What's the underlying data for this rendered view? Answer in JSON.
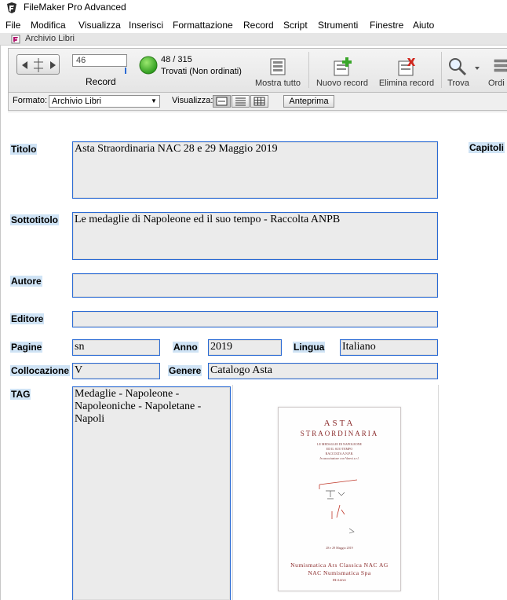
{
  "app": {
    "title": "FileMaker Pro Advanced"
  },
  "menu": [
    "File",
    "Modifica",
    "Visualizza",
    "Inserisci",
    "Formattazione",
    "Record",
    "Script",
    "Strumenti",
    "Finestre",
    "Aiuto"
  ],
  "window": {
    "title": "Archivio Libri"
  },
  "toolbar": {
    "record_value": "46",
    "record_label": "Record",
    "count": "48 / 315",
    "found_status": "Trovati (Non ordinati)",
    "buttons": {
      "show_all": "Mostra tutto",
      "new_record": "Nuovo record",
      "delete_record": "Elimina record",
      "find": "Trova",
      "sort": "Ordi"
    }
  },
  "layoutbar": {
    "format_label": "Formato:",
    "layout_value": "Archivio Libri",
    "view_label": "Visualizza:",
    "preview_label": "Anteprima"
  },
  "labels": {
    "titolo": "Titolo",
    "sottotitolo": "Sottotitolo",
    "autore": "Autore",
    "editore": "Editore",
    "pagine": "Pagine",
    "anno": "Anno",
    "lingua": "Lingua",
    "collocazione": "Collocazione",
    "genere": "Genere",
    "tag": "TAG",
    "capitoli": "Capitoli"
  },
  "record": {
    "titolo": "Asta Straordinaria  NAC 28 e 29 Maggio 2019",
    "sottotitolo": "Le medaglie di Napoleone ed il suo tempo - Raccolta ANPB",
    "autore": "",
    "editore": "",
    "pagine": "sn",
    "anno": "2019",
    "lingua": "Italiano",
    "collocazione": "V",
    "genere": "Catalogo Asta",
    "tag": "Medaglie - Napoleone - Napoleoniche - Napoletane - Napoli"
  },
  "cover": {
    "line1": "ASTA",
    "line2": "STRAORDINARIA",
    "line3": "LE MEDAGLIE DI NAPOLEONE",
    "line4": "ED IL SUO TEMPO",
    "line5": "RACCOLTA A.N.P.B.",
    "line6": "In associazione con Varesi s.r.l.",
    "date": "28 e 29 Maggio 2019",
    "publisher1": "Numismatica Ars Classica NAC AG",
    "publisher2": "NAC Numismatica Spa",
    "city": "Milano"
  },
  "colors": {
    "focus_border": "#2a6ad4",
    "label_bg": "#cfe3f5",
    "field_bg": "#ebebeb",
    "cover_text": "#8a2a2a"
  }
}
